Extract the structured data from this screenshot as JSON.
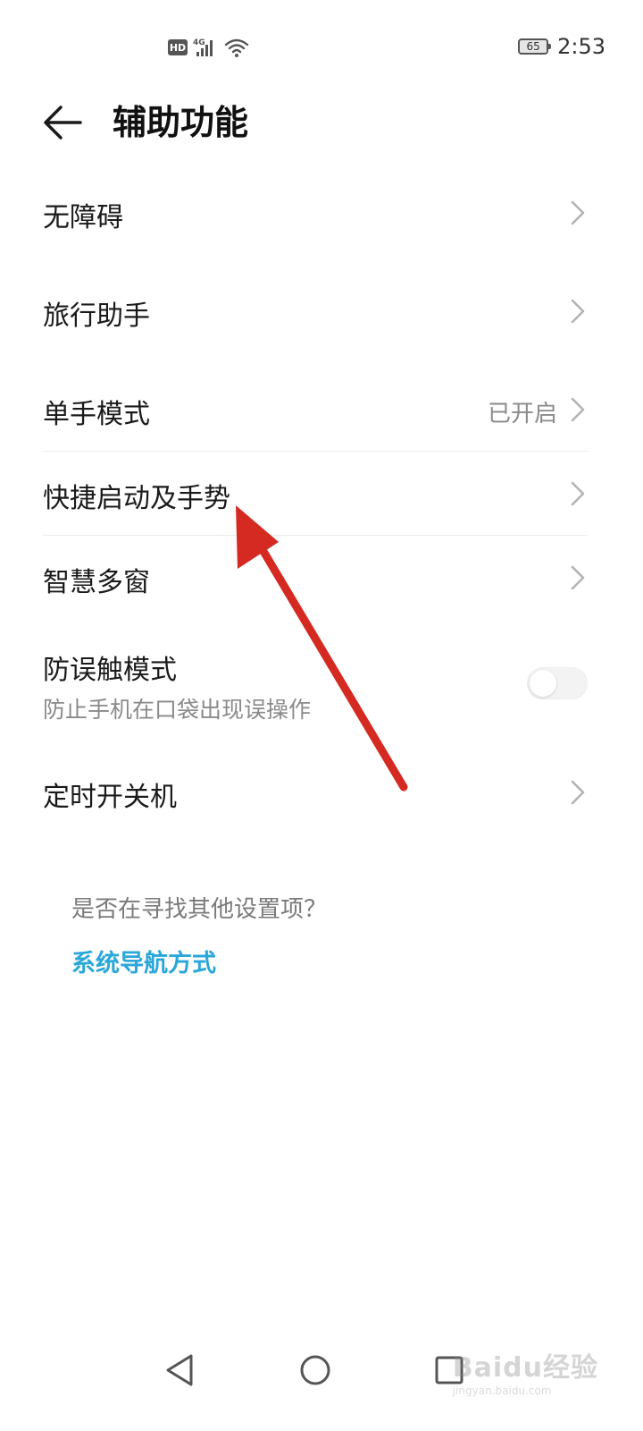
{
  "status_bar": {
    "hd_label": "HD",
    "network_label": "4G",
    "battery_level": "65",
    "time": "2:53",
    "icons": [
      "hd-icon",
      "signal-icon",
      "wifi-icon",
      "battery-icon"
    ]
  },
  "header": {
    "title": "辅助功能",
    "back_icon": "back-arrow-icon"
  },
  "settings": {
    "items": [
      {
        "label": "无障碍"
      },
      {
        "label": "旅行助手"
      },
      {
        "label": "单手模式",
        "value": "已开启"
      },
      {
        "label": "快捷启动及手势"
      },
      {
        "label": "智慧多窗"
      },
      {
        "label": "防误触模式",
        "subtitle": "防止手机在口袋出现误操作",
        "toggle_on": false
      },
      {
        "label": "定时开关机"
      }
    ]
  },
  "hint": {
    "question": "是否在寻找其他设置项？",
    "link": "系统导航方式"
  },
  "nav_bar": {
    "icons": [
      "nav-back-icon",
      "nav-home-icon",
      "nav-recents-icon"
    ]
  },
  "watermark": {
    "main": "Baidu经验",
    "sub": "jingyan.baidu.com"
  },
  "colors": {
    "accent": "#2aa7d8",
    "annotation_arrow": "#d42a22",
    "secondary_text": "#8a8a8a"
  }
}
